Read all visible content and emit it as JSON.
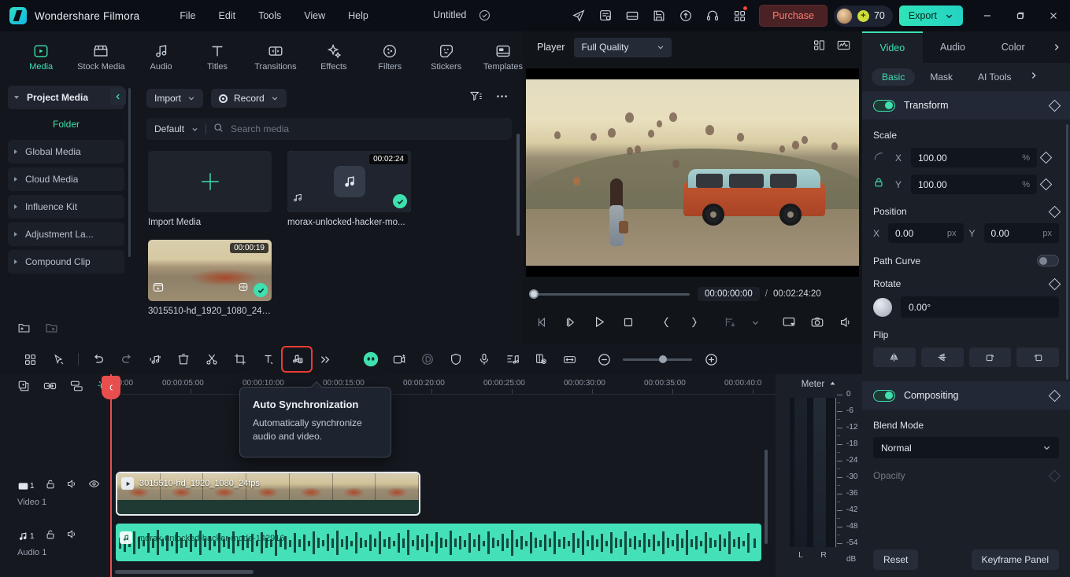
{
  "titlebar": {
    "app_name": "Wondershare Filmora",
    "menus": [
      "File",
      "Edit",
      "Tools",
      "View",
      "Help"
    ],
    "doc_title": "Untitled",
    "icons": [
      "send-icon",
      "task-list-icon",
      "layout-icon",
      "save-icon",
      "cloud-upload-icon",
      "headset-icon",
      "apps-grid-icon"
    ],
    "purchase_label": "Purchase",
    "credits": "70",
    "export_label": "Export",
    "window_controls": [
      "minimize",
      "maximize",
      "close"
    ]
  },
  "media_tabs": [
    {
      "label": "Media",
      "icon": "media-icon",
      "active": true
    },
    {
      "label": "Stock Media",
      "icon": "stock-media-icon",
      "active": false
    },
    {
      "label": "Audio",
      "icon": "audio-note-icon",
      "active": false
    },
    {
      "label": "Titles",
      "icon": "titles-text-icon",
      "active": false
    },
    {
      "label": "Transitions",
      "icon": "transitions-icon",
      "active": false
    },
    {
      "label": "Effects",
      "icon": "effects-sparkle-icon",
      "active": false
    },
    {
      "label": "Filters",
      "icon": "filters-disc-icon",
      "active": false
    },
    {
      "label": "Stickers",
      "icon": "stickers-face-icon",
      "active": false
    },
    {
      "label": "Templates",
      "icon": "templates-icon",
      "active": false
    }
  ],
  "folders": {
    "root": "Project Media",
    "section_label": "Folder",
    "items": [
      "Global Media",
      "Cloud Media",
      "Influence Kit",
      "Adjustment La...",
      "Compound Clip"
    ],
    "bottom_icons": [
      "new-folder-icon",
      "delete-folder-icon",
      "collapse-panel-icon"
    ]
  },
  "browser": {
    "import_label": "Import",
    "record_label": "Record",
    "filter_icon": "filter-icon",
    "more_icon": "more-options-icon",
    "sort_label": "Default",
    "search_placeholder": "Search media",
    "items": [
      {
        "name": "Import Media",
        "kind": "import",
        "duration": "",
        "selected": false
      },
      {
        "name": "morax-unlocked-hacker-mo...",
        "kind": "audio",
        "duration": "00:02:24",
        "selected": true
      },
      {
        "name": "3015510-hd_1920_1080_24fps",
        "kind": "video",
        "duration": "00:00:19",
        "selected": true
      }
    ]
  },
  "player": {
    "label": "Player",
    "quality": "Full Quality",
    "right_icons": [
      "split-view-icon",
      "scope-icon"
    ],
    "current_time": "00:00:00:00",
    "separator": "/",
    "total_time": "00:02:24:20",
    "transport_icons": [
      "prev-frame-icon",
      "next-frame-icon",
      "play-icon",
      "stop-icon",
      "mark-in-icon",
      "mark-out-icon",
      "export-frame-icon",
      "chevron-down-icon",
      "display-icon",
      "snapshot-icon",
      "volume-icon",
      "fullscreen-icon"
    ]
  },
  "properties": {
    "tabs": [
      {
        "label": "Video",
        "active": true
      },
      {
        "label": "Audio",
        "active": false
      },
      {
        "label": "Color",
        "active": false
      }
    ],
    "tab_next_icon": "chevron-right-icon",
    "sub_tabs": [
      {
        "label": "Basic",
        "active": true
      },
      {
        "label": "Mask",
        "active": false
      },
      {
        "label": "AI Tools",
        "active": false
      }
    ],
    "transform": {
      "title": "Transform",
      "enabled": true,
      "scale_label": "Scale",
      "scale_x_axis": "X",
      "scale_x": "100.00",
      "scale_x_unit": "%",
      "scale_y_axis": "Y",
      "scale_y": "100.00",
      "scale_y_unit": "%",
      "position_label": "Position",
      "pos_x_axis": "X",
      "pos_x": "0.00",
      "pos_x_unit": "px",
      "pos_y_axis": "Y",
      "pos_y": "0.00",
      "pos_y_unit": "px",
      "path_curve_label": "Path Curve",
      "path_curve_enabled": false,
      "rotate_label": "Rotate",
      "rotate_value": "0.00°",
      "flip_label": "Flip",
      "flip_icons": [
        "flip-horizontal-icon",
        "flip-vertical-icon",
        "rotate-cw-icon",
        "rotate-ccw-icon"
      ]
    },
    "compositing": {
      "title": "Compositing",
      "enabled": true,
      "blend_mode_label": "Blend Mode",
      "blend_mode_value": "Normal",
      "opacity_label": "Opacity"
    },
    "footer": {
      "reset_label": "Reset",
      "keyframe_label": "Keyframe Panel"
    }
  },
  "timeline_toolbar": {
    "icons": [
      {
        "name": "grid-view-icon",
        "highlighted": false
      },
      {
        "name": "select-tool-icon",
        "highlighted": false
      },
      {
        "name": "undo-icon",
        "highlighted": false
      },
      {
        "name": "redo-icon",
        "highlighted": false
      },
      {
        "name": "audio-detach-icon",
        "highlighted": false
      },
      {
        "name": "delete-icon",
        "highlighted": false
      },
      {
        "name": "split-scissors-icon",
        "highlighted": false
      },
      {
        "name": "crop-icon",
        "highlighted": false
      },
      {
        "name": "text-icon",
        "highlighted": false
      },
      {
        "name": "auto-synchronization-icon",
        "highlighted": true
      },
      {
        "name": "more-chevrons-icon",
        "highlighted": false
      },
      {
        "name": "ai-smart-icon",
        "highlighted": false
      },
      {
        "name": "ai-video-icon",
        "highlighted": false
      },
      {
        "name": "denoise-icon",
        "highlighted": false
      },
      {
        "name": "shield-icon",
        "highlighted": false
      },
      {
        "name": "microphone-icon",
        "highlighted": false
      },
      {
        "name": "audio-mixer-icon",
        "highlighted": false
      },
      {
        "name": "keyframe-view-icon",
        "highlighted": false
      },
      {
        "name": "fit-timeline-icon",
        "highlighted": false
      },
      {
        "name": "zoom-out-icon",
        "highlighted": false
      },
      {
        "name": "zoom-in-icon",
        "highlighted": false
      }
    ]
  },
  "tooltip": {
    "title": "Auto Synchronization",
    "body": "Automatically synchronize audio and video."
  },
  "timeline": {
    "head_tools": [
      "add-track-icon",
      "link-icon",
      "group-icon",
      "magnet-snap-icon"
    ],
    "ruler_labels": [
      "00:00",
      "00:00:05:00",
      "00:00:10:00",
      "00:00:15:00",
      "00:00:20:00",
      "00:00:25:00",
      "00:00:30:00",
      "00:00:35:00",
      "00:00:40:0"
    ],
    "playhead_time": "00:00:00:00",
    "tracks": [
      {
        "name": "Video 1",
        "index": "1",
        "type": "video",
        "icons": [
          "video-track-icon",
          "lock-icon",
          "mute-icon",
          "eye-icon"
        ],
        "clip": "3015510-hd_1920_1080_24fps"
      },
      {
        "name": "Audio 1",
        "index": "1",
        "type": "audio",
        "icons": [
          "audio-track-icon",
          "lock-icon",
          "mute-icon"
        ],
        "clip": "morax-unlocked-hacker-mode-142916"
      }
    ]
  },
  "meter": {
    "title": "Meter",
    "collapse_icon": "chevron-up-icon",
    "scale": [
      "0",
      "-6",
      "-12",
      "-18",
      "-24",
      "-30",
      "-36",
      "-42",
      "-48",
      "-54"
    ],
    "unit": "dB",
    "channels": [
      "L",
      "R"
    ]
  },
  "colors": {
    "accent": "#3ee0b0",
    "highlight": "#ee3b33",
    "playhead": "#e84e4e",
    "purchase": "#ff7b6e",
    "audio_clip": "#44e0b8"
  }
}
